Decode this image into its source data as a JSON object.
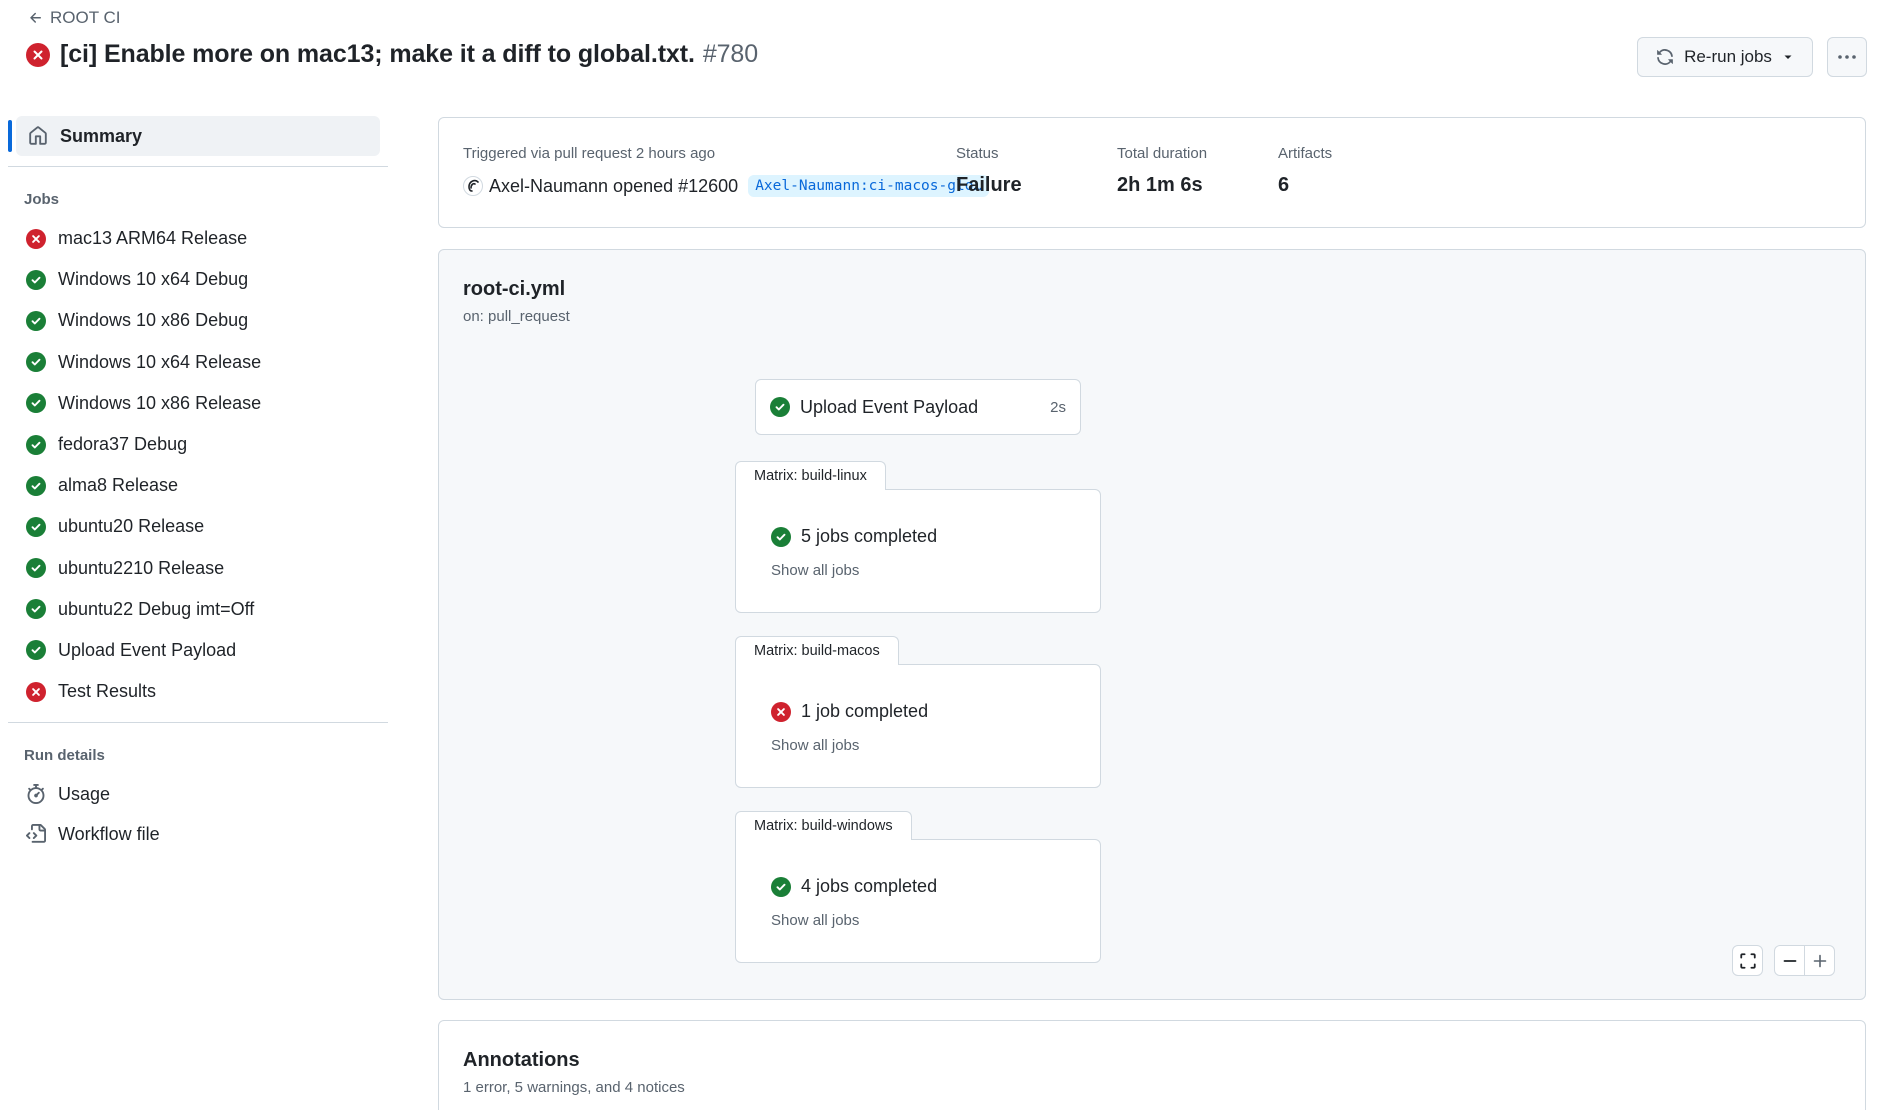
{
  "header": {
    "back_label": "ROOT CI",
    "title": "[ci] Enable more on mac13; make it a diff to global.txt.",
    "run_number": "#780",
    "rerun_label": "Re-run jobs"
  },
  "sidebar": {
    "summary_label": "Summary",
    "jobs_heading": "Jobs",
    "jobs": [
      {
        "label": "mac13 ARM64 Release",
        "status": "failure"
      },
      {
        "label": "Windows 10 x64 Debug",
        "status": "success"
      },
      {
        "label": "Windows 10 x86 Debug",
        "status": "success"
      },
      {
        "label": "Windows 10 x64 Release",
        "status": "success"
      },
      {
        "label": "Windows 10 x86 Release",
        "status": "success"
      },
      {
        "label": "fedora37 Debug",
        "status": "success"
      },
      {
        "label": "alma8 Release",
        "status": "success"
      },
      {
        "label": "ubuntu20 Release",
        "status": "success"
      },
      {
        "label": "ubuntu2210 Release",
        "status": "success"
      },
      {
        "label": "ubuntu22 Debug imt=Off",
        "status": "success"
      },
      {
        "label": "Upload Event Payload",
        "status": "success"
      },
      {
        "label": "Test Results",
        "status": "failure"
      }
    ],
    "run_details_heading": "Run details",
    "run_details": [
      {
        "label": "Usage",
        "icon": "stopwatch-icon"
      },
      {
        "label": "Workflow file",
        "icon": "file-code-icon"
      }
    ]
  },
  "summary": {
    "trigger_text": "Triggered via pull request 2 hours ago",
    "actor_text": "Axel-Naumann opened #12600",
    "branch": "Axel-Naumann:ci-macos-glo…",
    "status_label": "Status",
    "status_value": "Failure",
    "duration_label": "Total duration",
    "duration_value": "2h 1m 6s",
    "artifacts_label": "Artifacts",
    "artifacts_value": "6"
  },
  "workflow": {
    "name": "root-ci.yml",
    "trigger": "on: pull_request",
    "payload_job": {
      "label": "Upload Event Payload",
      "duration": "2s"
    },
    "matrices": [
      {
        "tab": "Matrix: build-linux",
        "summary": "5 jobs completed",
        "status": "success",
        "link": "Show all jobs"
      },
      {
        "tab": "Matrix: build-macos",
        "summary": "1 job completed",
        "status": "failure",
        "link": "Show all jobs"
      },
      {
        "tab": "Matrix: build-windows",
        "summary": "4 jobs completed",
        "status": "success",
        "link": "Show all jobs"
      }
    ]
  },
  "annotations": {
    "title": "Annotations",
    "subtitle": "1 error, 5 warnings, and 4 notices"
  },
  "colors": {
    "failure": "#cf222e",
    "success": "#1a7f37",
    "accent": "#0969da"
  }
}
